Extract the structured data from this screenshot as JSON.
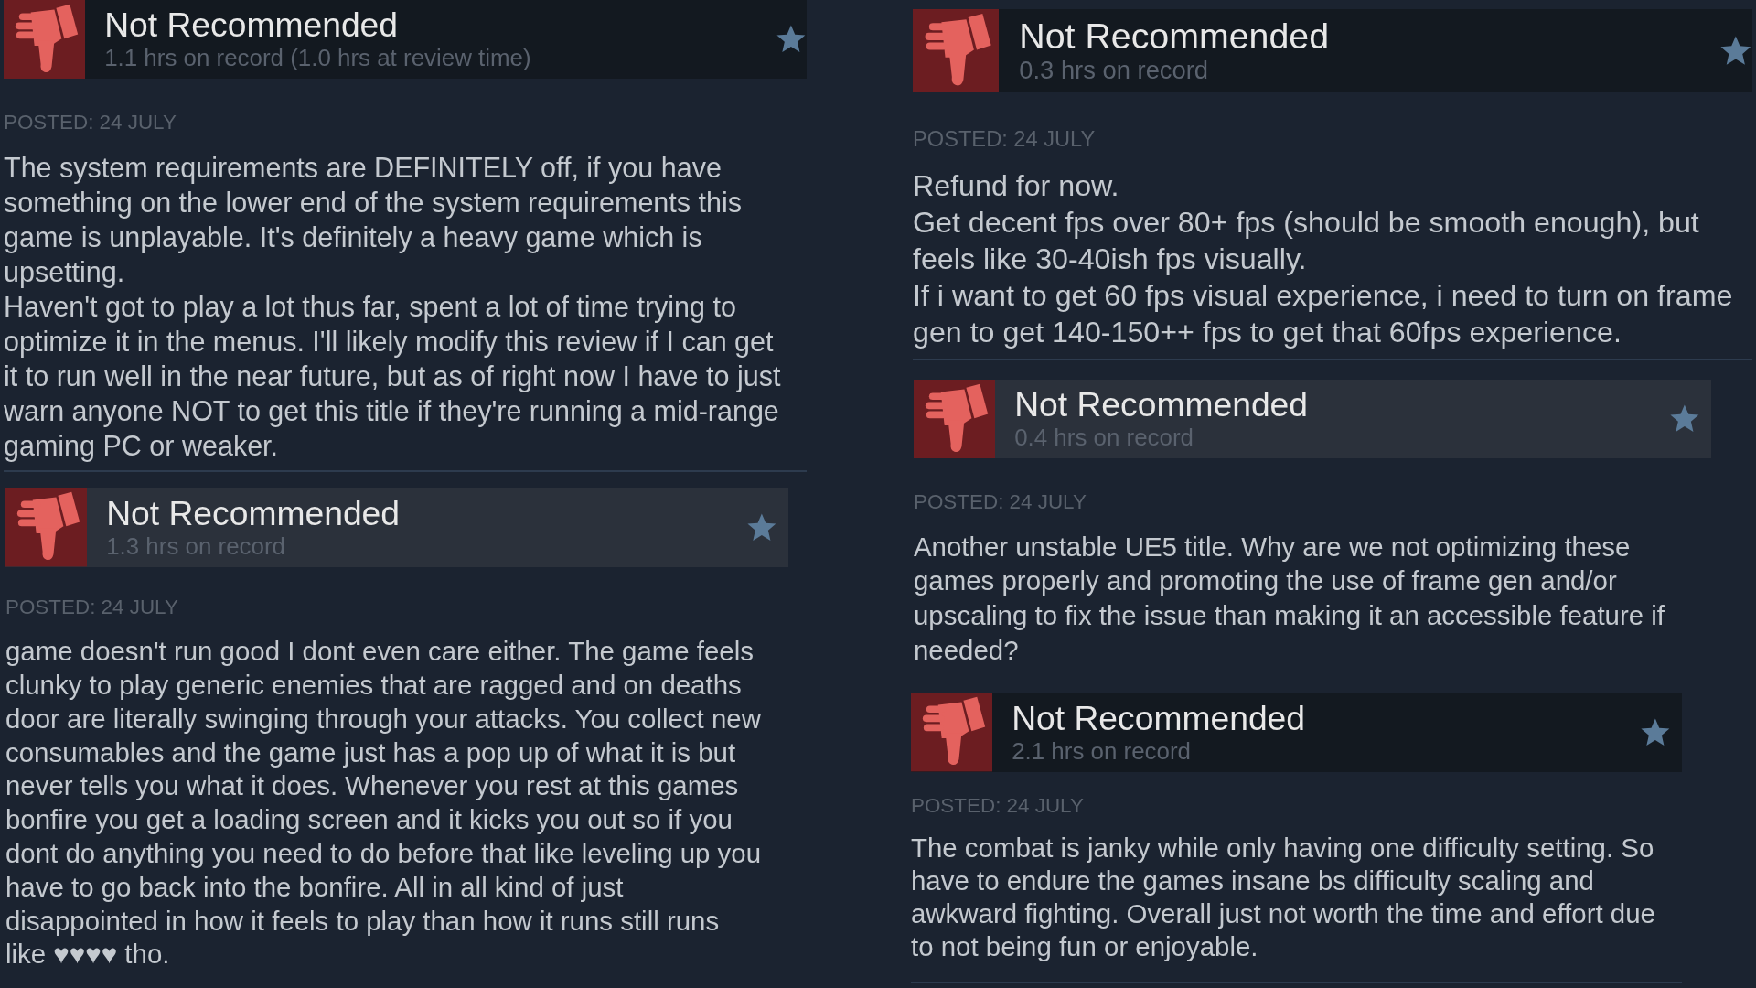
{
  "columns": [
    {
      "reviews": [
        {
          "verdict": "Not Recommended",
          "recommended": false,
          "highlighted": false,
          "hours": "1.1 hrs on record (1.0 hrs at review time)",
          "posted": "POSTED: 24 JULY",
          "text": "The system requirements are DEFINITELY off, if you have something on the lower end of the system requirements this game is unplayable. It's definitely a heavy game which is upsetting.\nHaven't got to play a lot thus far, spent a lot of time trying to optimize it in the menus. I'll likely modify this review if I can get it to run well in the near future, but as of right now I have to just warn anyone NOT to get this title if they're running a mid-range gaming PC or weaker."
        },
        {
          "verdict": "Not Recommended",
          "recommended": false,
          "highlighted": true,
          "hours": "1.3 hrs on record",
          "posted": "POSTED: 24 JULY",
          "text": "game doesn't run good I dont even care either. The game feels clunky to play generic enemies that are ragged and on deaths door are literally swinging through your attacks. You collect new consumables and the game just has a pop up of what it is but never tells you what it does. Whenever you rest at this games bonfire you get a loading screen and it kicks you out so if you dont do anything you need to do before that like leveling up you have to go back into the bonfire. All in all kind of just disappointed in how it feels to play than how it runs still runs like ♥♥♥♥ tho."
        }
      ]
    },
    {
      "reviews": [
        {
          "verdict": "Not Recommended",
          "recommended": false,
          "highlighted": false,
          "hours": "0.3 hrs on record",
          "posted": "POSTED: 24 JULY",
          "text": "Refund for now.\nGet decent fps over 80+ fps (should be smooth enough), but feels like 30-40ish fps visually.\nIf i want to get 60 fps visual experience, i need to turn on frame gen to get 140-150++ fps to get that 60fps experience."
        },
        {
          "verdict": "Not Recommended",
          "recommended": false,
          "highlighted": true,
          "hours": "0.4 hrs on record",
          "posted": "POSTED: 24 JULY",
          "text": "Another unstable UE5 title. Why are we not optimizing these games properly and promoting the use of frame gen and/or upscaling to fix the issue than making it an accessible feature if needed?"
        },
        {
          "verdict": "Not Recommended",
          "recommended": false,
          "highlighted": false,
          "hours": "2.1 hrs on record",
          "posted": "POSTED: 24 JULY",
          "text": "The combat is janky while only having one difficulty setting. So have to endure the games insane bs difficulty scaling and awkward fighting. Overall just not worth the time and effort due to not being fun or enjoyable."
        }
      ]
    }
  ]
}
